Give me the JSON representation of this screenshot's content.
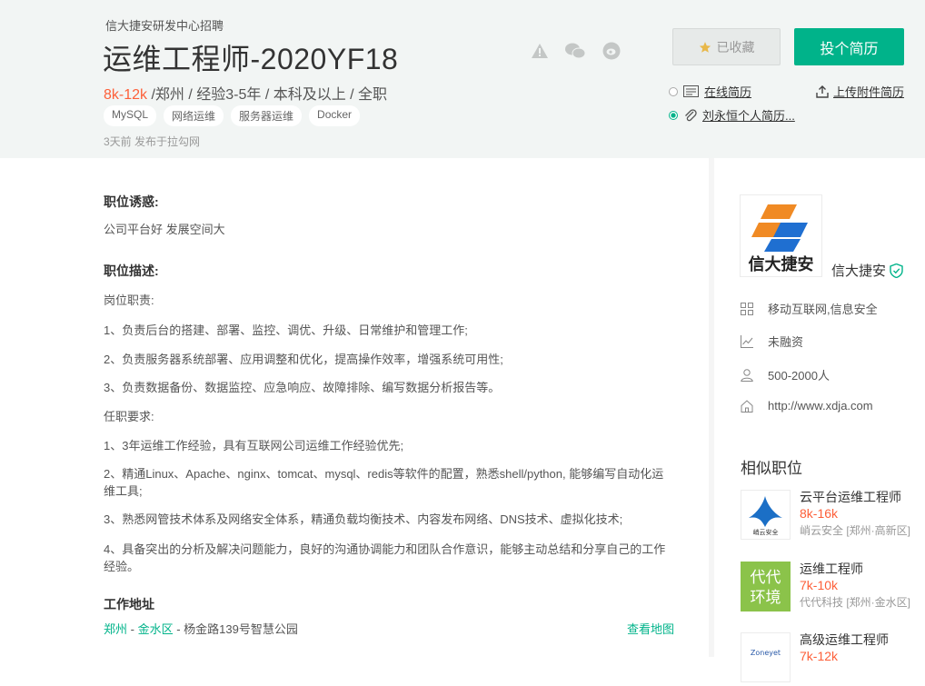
{
  "header": {
    "company_line": "信大捷安研发中心招聘",
    "title": "运维工程师-2020YF18",
    "salary": "8k-12k",
    "meta_rest": " /郑州 / 经验3-5年 / 本科及以上 / 全职",
    "tags": [
      "MySQL",
      "网络运维",
      "服务器运维",
      "Docker"
    ],
    "posted": "3天前  发布于拉勾网",
    "collect_label": "已收藏",
    "apply_label": "投个简历",
    "online_resume": "在线简历",
    "attached_resume": "刘永恒个人简历...",
    "upload_label": "上传附件简历"
  },
  "body": {
    "perks_title": "职位诱惑:",
    "perks": "公司平台好 发展空间大",
    "desc_title": "职位描述:",
    "duty_title": "岗位职责:",
    "duties": [
      "1、负责后台的搭建、部署、监控、调优、升级、日常维护和管理工作;",
      "2、负责服务器系统部署、应用调整和优化，提高操作效率，增强系统可用性;",
      "3、负责数据备份、数据监控、应急响应、故障排除、编写数据分析报告等。"
    ],
    "req_title": "任职要求:",
    "reqs": [
      "1、3年运维工作经验，具有互联网公司运维工作经验优先;",
      "2、精通Linux、Apache、nginx、tomcat、mysql、redis等软件的配置，熟悉shell/python, 能够编写自动化运维工具;",
      "3、熟悉网管技术体系及网络安全体系，精通负载均衡技术、内容发布网络、DNS技术、虚拟化技术;",
      "4、具备突出的分析及解决问题能力，良好的沟通协调能力和团队合作意识，能够主动总结和分享自己的工作经验。"
    ],
    "address_title": "工作地址",
    "address_city": "郑州",
    "address_district": "金水区",
    "address_street": " - 杨金路139号智慧公园",
    "map_link": "查看地图"
  },
  "company": {
    "logo_text": "信大捷安",
    "name": "信大捷安",
    "industry": "移动互联网,信息安全",
    "funding": "未融资",
    "size": "500-2000人",
    "website": "http://www.xdja.com"
  },
  "similar": {
    "title": "相似职位",
    "items": [
      {
        "title": "云平台运维工程师",
        "salary": "8k-16k",
        "company": "峭云安全 [郑州·高新区]",
        "logo_text": "峭云安全"
      },
      {
        "title": "运维工程师",
        "salary": "7k-10k",
        "company": "代代科技 [郑州·金水区]",
        "logo_text": "代代环境"
      },
      {
        "title": "高级运维工程师",
        "salary": "7k-12k",
        "company": "",
        "logo_text": "Zoneyet"
      }
    ]
  },
  "colors": {
    "accent": "#00b38a",
    "salary": "#fd5f39"
  }
}
